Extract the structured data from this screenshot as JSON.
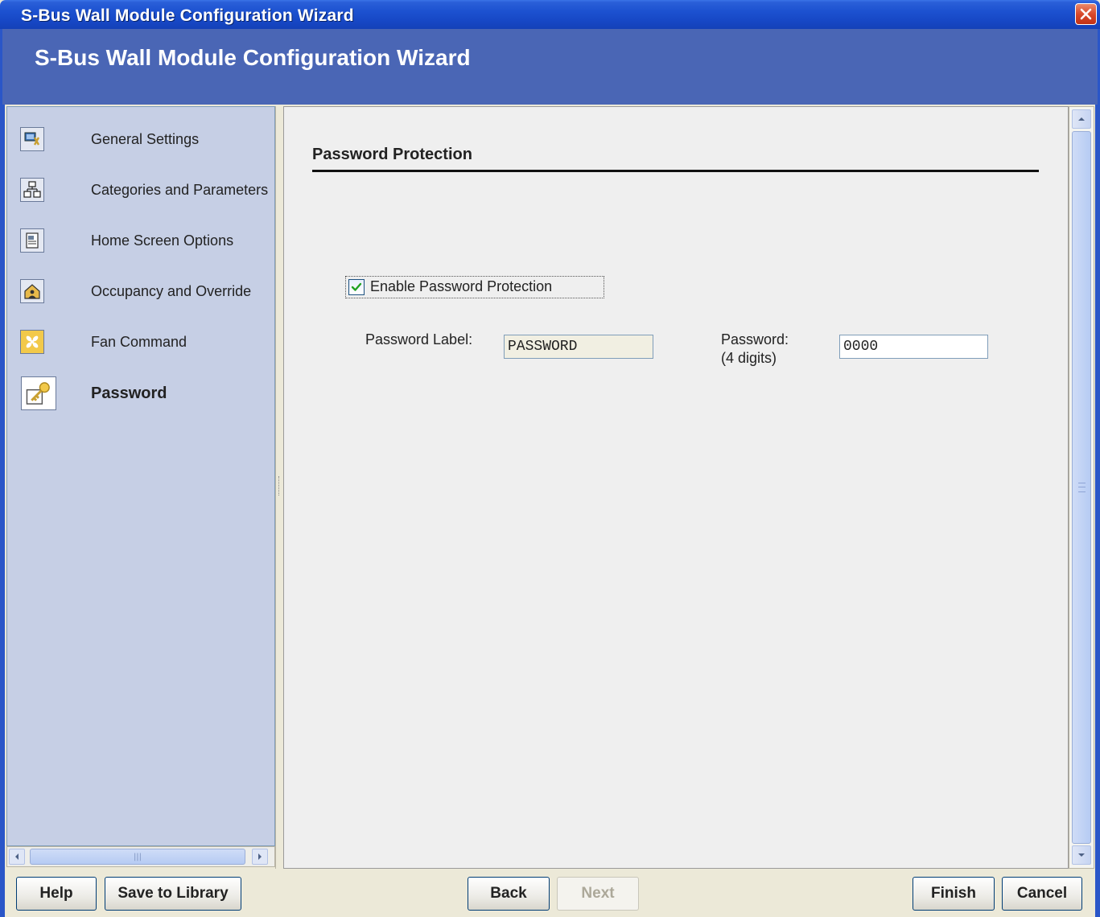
{
  "window": {
    "title": "S-Bus Wall Module Configuration Wizard",
    "header_title": "S-Bus Wall Module Configuration Wizard"
  },
  "sidebar": {
    "items": [
      {
        "label": "General Settings",
        "icon": "settings-icon",
        "active": false
      },
      {
        "label": "Categories and Parameters",
        "icon": "hierarchy-icon",
        "active": false
      },
      {
        "label": "Home Screen Options",
        "icon": "home-screen-icon",
        "active": false
      },
      {
        "label": "Occupancy and Override",
        "icon": "occupancy-icon",
        "active": false
      },
      {
        "label": "Fan Command",
        "icon": "fan-icon",
        "active": false
      },
      {
        "label": "Password",
        "icon": "key-icon",
        "active": true
      }
    ]
  },
  "content": {
    "section_title": "Password Protection",
    "enable_checkbox": {
      "label": "Enable Password Protection",
      "checked": true
    },
    "password_label": {
      "label": "Password Label:",
      "value": "PASSWORD"
    },
    "password": {
      "label_line1": "Password:",
      "label_line2": "(4 digits)",
      "value": "0000"
    }
  },
  "buttons": {
    "help": "Help",
    "save_to_library": "Save to Library",
    "back": "Back",
    "next": "Next",
    "finish": "Finish",
    "cancel": "Cancel"
  },
  "colors": {
    "title_bar": "#1c51d0",
    "header_band": "#4a66b5",
    "sidebar_bg": "#c6cfe5",
    "content_bg": "#efefef"
  }
}
